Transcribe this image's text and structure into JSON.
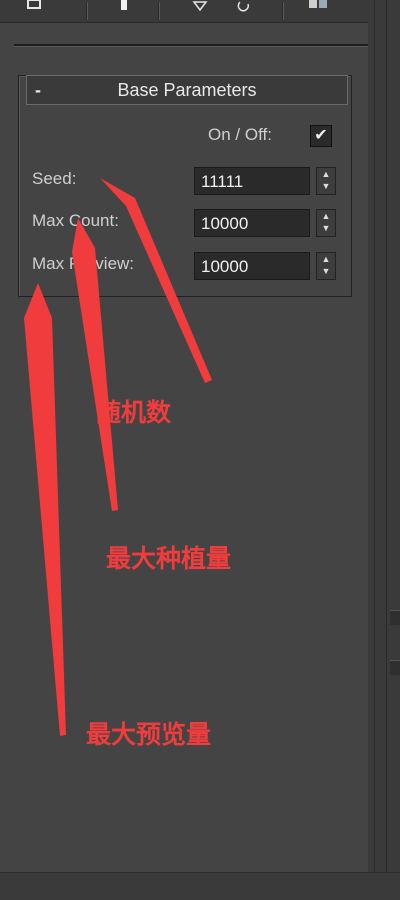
{
  "toolbar": {
    "icons": [
      "pin-icon",
      "pipe-icon",
      "funnel-icon",
      "undo-icon",
      "config-icon"
    ]
  },
  "rollout": {
    "collapse_symbol": "-",
    "title": "Base Parameters",
    "on_off_label": "On / Off:",
    "checked": true,
    "seed_label": "Seed:",
    "seed_value": "11111",
    "max_count_label": "Max Count:",
    "max_count_value": "10000",
    "max_preview_label": "Max Preview:",
    "max_preview_value": "10000"
  },
  "annotations": {
    "seed": "随机数",
    "max_count": "最大种植量",
    "max_preview": "最大预览量"
  },
  "colors": {
    "panel_bg": "#444444",
    "annotation": "#f03c3c"
  }
}
